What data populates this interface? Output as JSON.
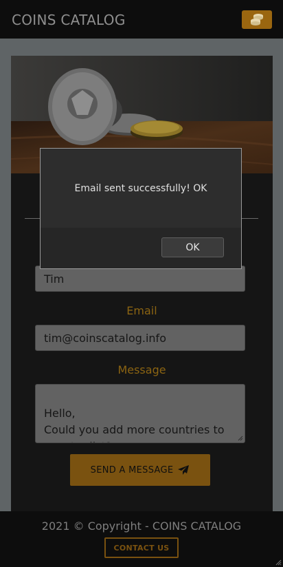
{
  "header": {
    "brand": "COINS CATALOG",
    "menu_icon": "coins-stack-icon"
  },
  "form": {
    "name_value": "Tim",
    "email_label": "Email",
    "email_value": "tim@coinscatalog.info",
    "message_label": "Message",
    "message_value": "Hello,\nCould you add more countries to country list?",
    "send_label": "SEND A MESSAGE",
    "send_icon": "paper-plane-icon"
  },
  "dialog": {
    "message": "Email sent successfully! OK",
    "ok_label": "OK"
  },
  "footer": {
    "copyright": "2021 © Copyright -  COINS CATALOG",
    "contact_label": "CONTACT US"
  },
  "colors": {
    "accent": "#c8870f",
    "background": "#3a3a3a",
    "panel": "#262626"
  }
}
